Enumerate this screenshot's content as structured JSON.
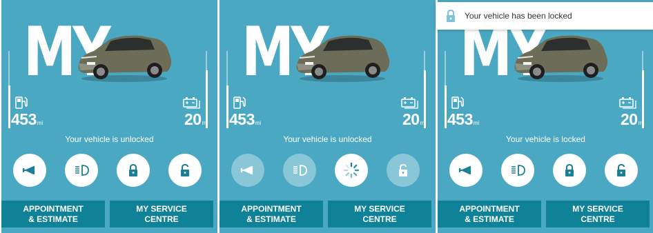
{
  "panels": [
    {
      "brand_text": "MY",
      "fuel_range": "453",
      "battery_range": "20",
      "unit": "mi",
      "fuel_level": 0.55,
      "battery_level": 0.75,
      "status": "Your vehicle is unlocked",
      "buttons": [
        {
          "icon": "horn-icon",
          "state": "active"
        },
        {
          "icon": "headlights-icon",
          "state": "active"
        },
        {
          "icon": "lock-icon",
          "state": "active"
        },
        {
          "icon": "unlock-icon",
          "state": "active"
        }
      ],
      "cta_appointment": [
        "APPOINTMENT",
        "& ESTIMATE"
      ],
      "cta_service": [
        "MY SERVICE",
        "CENTRE"
      ]
    },
    {
      "brand_text": "MY",
      "fuel_range": "453",
      "battery_range": "20",
      "unit": "mi",
      "fuel_level": 0.55,
      "battery_level": 0.75,
      "status": "Your vehicle is unlocked",
      "buttons": [
        {
          "icon": "horn-icon",
          "state": "disabled"
        },
        {
          "icon": "headlights-icon",
          "state": "disabled"
        },
        {
          "icon": "loading-spinner-icon",
          "state": "loading"
        },
        {
          "icon": "unlock-icon",
          "state": "disabled"
        }
      ],
      "cta_appointment": [
        "APPOINTMENT",
        "& ESTIMATE"
      ],
      "cta_service": [
        "MY SERVICE",
        "CENTRE"
      ]
    },
    {
      "brand_text": "MY",
      "fuel_range": "453",
      "battery_range": "20",
      "unit": "mi",
      "fuel_level": 0.55,
      "battery_level": 0.75,
      "status": "Your vehicle is locked",
      "buttons": [
        {
          "icon": "horn-icon",
          "state": "active"
        },
        {
          "icon": "headlights-icon",
          "state": "active"
        },
        {
          "icon": "lock-icon",
          "state": "active"
        },
        {
          "icon": "unlock-icon",
          "state": "active"
        }
      ],
      "cta_appointment": [
        "APPOINTMENT",
        "& ESTIMATE"
      ],
      "cta_service": [
        "MY SERVICE",
        "CENTRE"
      ]
    }
  ],
  "toast": {
    "icon": "lock-icon",
    "message": "Your vehicle has been locked"
  },
  "colors": {
    "panel_bg": "#4aa8c2",
    "cta_bg": "#0f8297",
    "icon_teal": "#1b7f96",
    "icon_light": "#4aa8c2",
    "car_body": "#6b6d58"
  }
}
